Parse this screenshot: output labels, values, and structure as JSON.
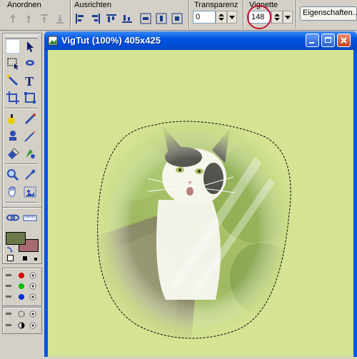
{
  "toolbar": {
    "groups": {
      "anordnen": "Anordnen",
      "ausrichten": "Ausrichten",
      "transparenz": "Transparenz",
      "vignette": "Vignette"
    },
    "transparenz_value": "0",
    "vignette_value": "148",
    "properties_label": "Eigenschaften..."
  },
  "window": {
    "title": "VigTut (100%) 405x425"
  },
  "colors": {
    "canvas_bg": "#d5e494",
    "title_blue": "#0055e5",
    "close_red": "#e0503a",
    "annotation_red": "#c8102e",
    "fg_swatch": "#6c7a4a",
    "bg_swatch": "#a66a70"
  },
  "icons": [
    "arrow-up-icon",
    "arrow-down-icon",
    "align-icon",
    "pointer-icon",
    "text-tool-icon",
    "crop-icon",
    "brush-icon",
    "eraser-icon",
    "zoom-icon",
    "grid-icon",
    "color-swatch-icon"
  ]
}
